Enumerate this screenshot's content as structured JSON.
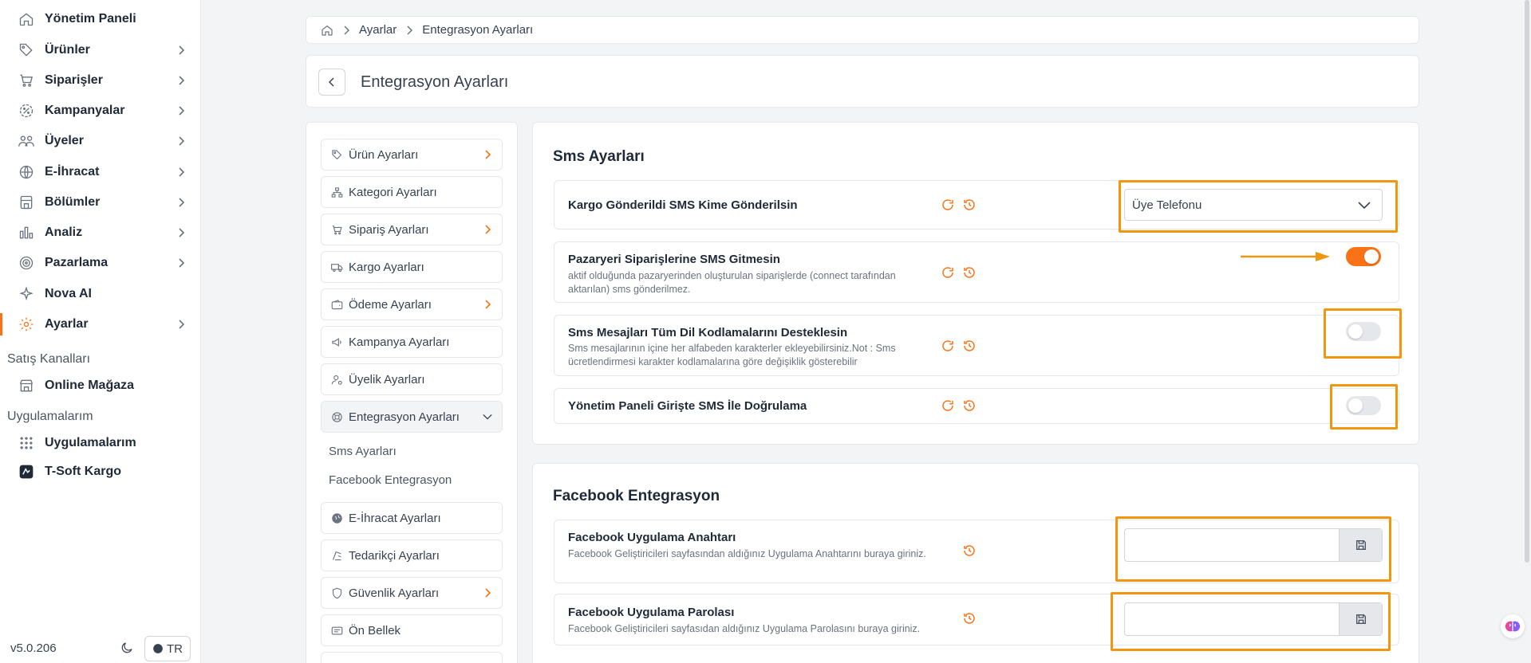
{
  "sidebar": {
    "items": [
      {
        "label": "Yönetim Paneli",
        "icon": "home-icon",
        "has_chevron": false
      },
      {
        "label": "Ürünler",
        "icon": "tag-icon",
        "has_chevron": true
      },
      {
        "label": "Siparişler",
        "icon": "cart-icon",
        "has_chevron": true
      },
      {
        "label": "Kampanyalar",
        "icon": "discount-icon",
        "has_chevron": true
      },
      {
        "label": "Üyeler",
        "icon": "users-icon",
        "has_chevron": true
      },
      {
        "label": "E-İhracat",
        "icon": "globe-icon",
        "has_chevron": true
      },
      {
        "label": "Bölümler",
        "icon": "sections-icon",
        "has_chevron": true
      },
      {
        "label": "Analiz",
        "icon": "chart-icon",
        "has_chevron": true
      },
      {
        "label": "Pazarlama",
        "icon": "target-icon",
        "has_chevron": true
      },
      {
        "label": "Nova AI",
        "icon": "sparkle-icon",
        "has_chevron": false
      },
      {
        "label": "Ayarlar",
        "icon": "gear-icon",
        "has_chevron": true,
        "active": true
      }
    ],
    "sales_channels_label": "Satış Kanalları",
    "online_store_label": "Online Mağaza",
    "apps_label": "Uygulamalarım",
    "apps_item_label": "Uygulamalarım",
    "tsoft_label": "T-Soft Kargo",
    "version": "v5.0.206",
    "lang": "TR"
  },
  "breadcrumb": {
    "items": [
      "Ayarlar",
      "Entegrasyon Ayarları"
    ]
  },
  "page": {
    "title": "Entegrasyon Ayarları"
  },
  "settings_nav": {
    "items": [
      {
        "label": "Ürün Ayarları",
        "icon": "tag-icon",
        "chevron": true
      },
      {
        "label": "Kategori Ayarları",
        "icon": "hierarchy-icon",
        "chevron": false
      },
      {
        "label": "Sipariş Ayarları",
        "icon": "cart-icon",
        "chevron": true
      },
      {
        "label": "Kargo Ayarları",
        "icon": "truck-icon",
        "chevron": false
      },
      {
        "label": "Ödeme Ayarları",
        "icon": "wallet-icon",
        "chevron": true
      },
      {
        "label": "Kampanya Ayarları",
        "icon": "megaphone-icon",
        "chevron": false
      },
      {
        "label": "Üyelik Ayarları",
        "icon": "user-settings-icon",
        "chevron": false
      },
      {
        "label": "Entegrasyon Ayarları",
        "icon": "lifebuoy-icon",
        "chevron": true,
        "expanded": true
      }
    ],
    "sub_items": [
      "Sms Ayarları",
      "Facebook Entegrasyon"
    ],
    "items_after": [
      {
        "label": "E-İhracat Ayarları",
        "icon": "globe-icon",
        "chevron": false
      },
      {
        "label": "Tedarikçi Ayarları",
        "icon": "supplier-icon",
        "chevron": false
      },
      {
        "label": "Güvenlik Ayarları",
        "icon": "shield-icon",
        "chevron": true
      },
      {
        "label": "Ön Bellek",
        "icon": "cache-icon",
        "chevron": false
      }
    ]
  },
  "sms": {
    "title": "Sms Ayarları",
    "rows": [
      {
        "title": "Kargo Gönderildi SMS Kime Gönderilsin",
        "desc": "",
        "control": "select",
        "value": "Üye Telefonu"
      },
      {
        "title": "Pazaryeri Siparişlerine SMS Gitmesin",
        "desc": "aktif olduğunda pazaryerinden oluşturulan siparişlerde (connect tarafından aktarılan) sms gönderilmez.",
        "control": "toggle",
        "on": true
      },
      {
        "title": "Sms Mesajları Tüm Dil Kodlamalarını Desteklesin",
        "desc": "Sms mesajlarının içine her alfabeden karakterler ekleyebilirsiniz.Not : Sms ücretlendirmesi karakter kodlamalarına göre değişiklik gösterebilir",
        "control": "toggle",
        "on": false
      },
      {
        "title": "Yönetim Paneli Girişte SMS İle Doğrulama",
        "desc": "",
        "control": "toggle",
        "on": false
      }
    ]
  },
  "facebook": {
    "title": "Facebook Entegrasyon",
    "rows": [
      {
        "title": "Facebook Uygulama Anahtarı",
        "desc": "Facebook Geliştiricileri sayfasından aldığınız Uygulama Anahtarını buraya giriniz.",
        "value": ""
      },
      {
        "title": "Facebook Uygulama Parolası",
        "desc": "Facebook Geliştiricileri sayfasıdan aldığınız Uygulama Parolasını buraya giriniz.",
        "value": ""
      }
    ]
  },
  "colors": {
    "accent": "#f97316",
    "highlight": "#f0960f"
  }
}
